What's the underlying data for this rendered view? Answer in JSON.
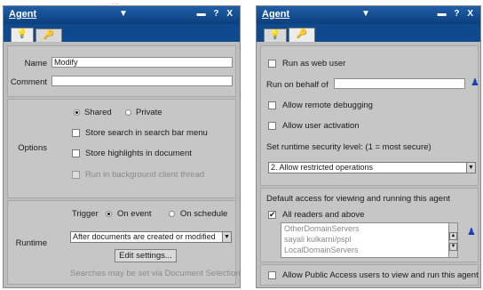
{
  "top_dots": "...",
  "left": {
    "title": "Agent",
    "dropdown": "▼",
    "controls": "▬ ? X",
    "tabs": [
      "💡",
      "🔑"
    ],
    "name_label": "Name",
    "name_value": "Modify",
    "comment_label": "Comment",
    "comment_value": "",
    "options_label": "Options",
    "shared": "Shared",
    "private": "Private",
    "store_search": "Store search in search bar menu",
    "store_highlights": "Store highlights in document",
    "run_background": "Run in background client thread",
    "runtime_label": "Runtime",
    "trigger_label": "Trigger",
    "on_event": "On event",
    "on_schedule": "On schedule",
    "trigger_select": "After documents are created or modified",
    "edit_settings": "Edit settings...",
    "searches_note": "Searches may be set via Document Selection"
  },
  "right": {
    "title": "Agent",
    "dropdown": "▼",
    "controls": "▬ ? X",
    "tabs": [
      "💡",
      "🔑"
    ],
    "run_as_web_user": "Run as web user",
    "run_on_behalf": "Run on behalf of",
    "run_on_behalf_value": "",
    "allow_remote_debug": "Allow remote debugging",
    "allow_user_activation": "Allow user activation",
    "security_level_label": "Set runtime security level: (1 = most secure)",
    "security_level_value": "2. Allow restricted operations",
    "default_access_label": "Default access for viewing and running this agent",
    "all_readers": "All readers and above",
    "all_readers_checked": "✔",
    "access_list": [
      "OtherDomainServers",
      "sayali kulkarni/pspl",
      "LocalDomainServers"
    ],
    "allow_public": "Allow Public Access users to view and run this agent"
  }
}
